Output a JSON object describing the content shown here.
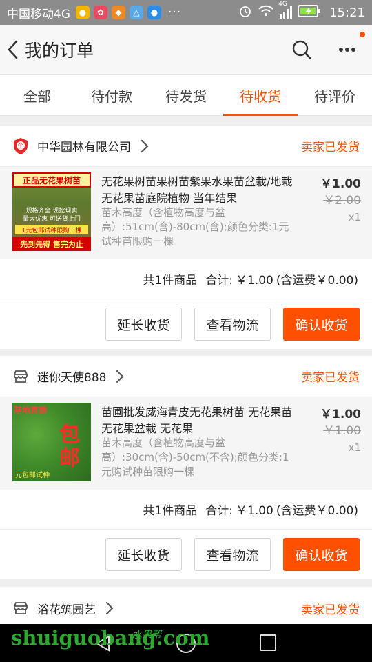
{
  "status_bar": {
    "carrier": "中国移动4G",
    "network": "4G",
    "time": "15:21"
  },
  "header": {
    "title": "我的订单"
  },
  "tabs": [
    {
      "label": "全部",
      "active": false
    },
    {
      "label": "待付款",
      "active": false
    },
    {
      "label": "待发货",
      "active": false
    },
    {
      "label": "待收货",
      "active": true
    },
    {
      "label": "待评价",
      "active": false
    }
  ],
  "orders": [
    {
      "shop_name": "中华园林有限公司",
      "shop_icon": "enterprise-badge-icon",
      "status": "卖家已发货",
      "item": {
        "title": "无花果树苗果树苗紫果水果苗盆栽/地栽无花果苗庭院植物 当年结果",
        "spec": "苗木高度（含植物高度与盆高）:51cm(含)-80cm(含);颜色分类:1元试种苗限购一棵",
        "price": "￥1.00",
        "original_price": "￥2.00",
        "quantity": "x1",
        "thumb_text_top": "正品无花果树苗",
        "thumb_text_mid": "规格齐全 现挖现卖",
        "thumb_text_mid2": "量大优惠 可送货上门",
        "thumb_text_low": "1元包邮试种限购一棵",
        "thumb_text_bottom": "先到先得 售完为止"
      },
      "summary": {
        "count": "共1件商品",
        "total_label": "合计:",
        "total": "￥1.00",
        "shipping": "(含运费￥0.00)"
      },
      "buttons": {
        "extend": "延长收货",
        "logistics": "查看物流",
        "confirm": "确认收货"
      }
    },
    {
      "shop_name": "迷你天使888",
      "shop_icon": "store-icon",
      "status": "卖家已发货",
      "item": {
        "title": "苗圃批发威海青皮无花果树苗 无花果苗 无花果盆栽 无花果",
        "spec": "苗木高度（含植物高度与盆高）:30cm(含)-50cm(不含);颜色分类:1元购试种苗限购一棵",
        "price": "￥1.00",
        "original_price": "￥1.00",
        "quantity": "x1",
        "thumb_text_top": "基地直销",
        "thumb_text_big": "包邮",
        "thumb_text_bottom": "元包邮试种"
      },
      "summary": {
        "count": "共1件商品",
        "total_label": "合计:",
        "total": "￥1.00",
        "shipping": "(含运费￥0.00)"
      },
      "buttons": {
        "extend": "延长收货",
        "logistics": "查看物流",
        "confirm": "确认收货"
      }
    },
    {
      "shop_name": "浴花筑园艺",
      "shop_icon": "store-icon",
      "status": "卖家已发货"
    }
  ],
  "watermark": {
    "text": "shuiguobang.com",
    "cn": "水果帮"
  },
  "colors": {
    "accent": "#ff5000",
    "status_bar": "#8c8c8c"
  }
}
